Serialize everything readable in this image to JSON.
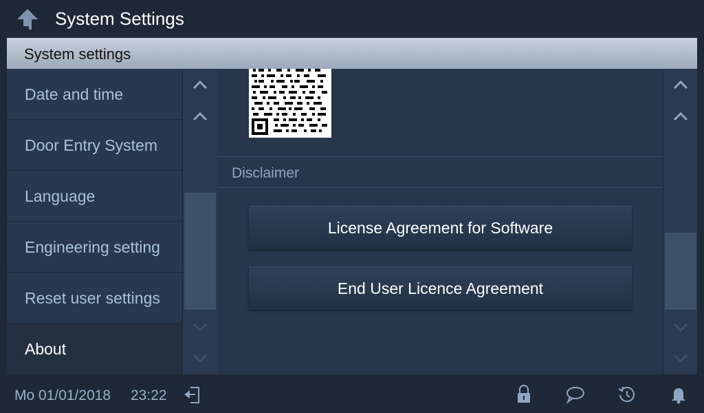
{
  "header": {
    "title": "System Settings",
    "back_icon": "back-arrow-icon"
  },
  "section": {
    "title": "System settings"
  },
  "menu": {
    "items": [
      {
        "label": "Date and time"
      },
      {
        "label": "Door Entry System"
      },
      {
        "label": "Language"
      },
      {
        "label": "Engineering setting"
      },
      {
        "label": "Reset user settings"
      },
      {
        "label": "About",
        "selected": true
      }
    ]
  },
  "content": {
    "disclaimer_label": "Disclaimer",
    "buttons": [
      {
        "label": "License Agreement for Software"
      },
      {
        "label": "End User Licence Agreement"
      }
    ]
  },
  "status": {
    "date": "Mo 01/01/2018",
    "time": "23:22",
    "icons": [
      "door-icon",
      "lock-icon",
      "message-icon",
      "history-icon",
      "bell-icon"
    ]
  },
  "colors": {
    "accent": "#a9c2dc",
    "background": "#1e2836",
    "panel": "#28384e"
  }
}
